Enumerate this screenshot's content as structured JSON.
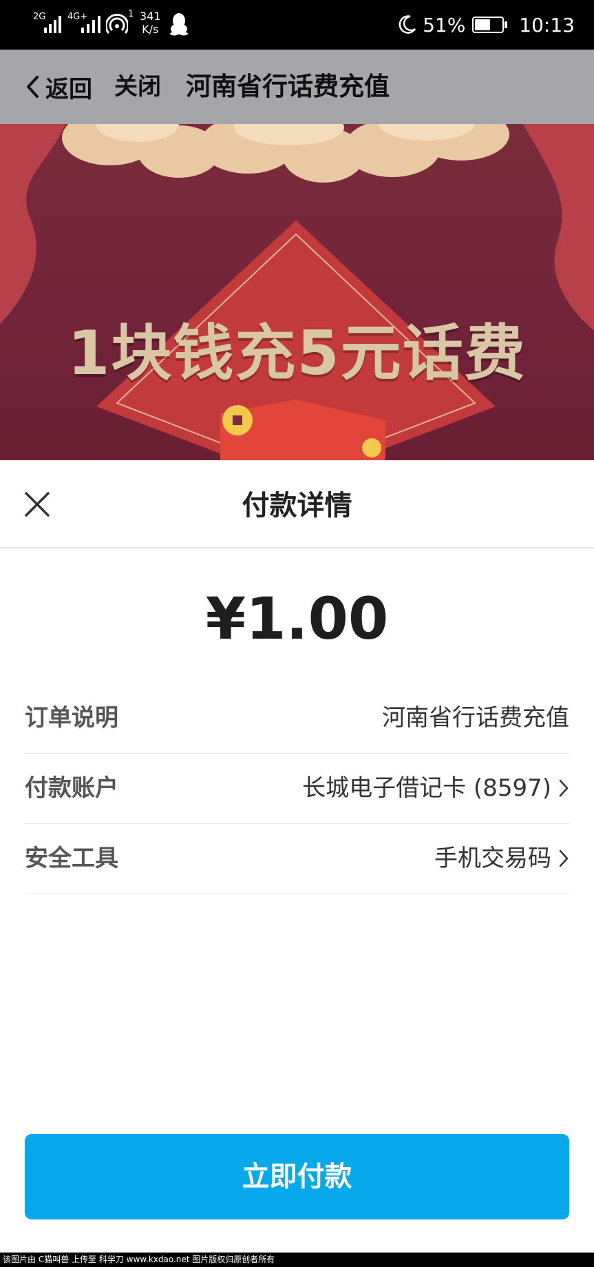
{
  "status_bar": {
    "signal1": "2G",
    "signal2": "4G+",
    "hotspot_count": "1",
    "net_speed": "341",
    "net_unit": "K/s",
    "battery_percent": "51%",
    "battery_level": 0.51,
    "time": "10:13",
    "icons": [
      "signal-icon",
      "wifi-hotspot-icon",
      "qq-icon",
      "moon-icon",
      "battery-icon"
    ]
  },
  "nav": {
    "back_label": "返回",
    "close_label": "关闭",
    "title": "河南省行话费充值"
  },
  "banner": {
    "headline": "1块钱充5元话费"
  },
  "payment": {
    "title": "付款详情",
    "amount": "¥1.00",
    "rows": [
      {
        "label": "订单说明",
        "value": "河南省行话费充值"
      },
      {
        "label": "付款账户",
        "value": "长城电子借记卡 (8597)"
      },
      {
        "label": "安全工具",
        "value": "手机交易码"
      }
    ],
    "pay_button": "立即付款"
  },
  "colors": {
    "accent": "#08a8ed",
    "nav_bg": "#a6a5aa",
    "banner_bg": "#73243a"
  },
  "watermark": "该图片由 C猫叫兽 上传至 科学刀 www.kxdao.net 图片版权归原创者所有"
}
